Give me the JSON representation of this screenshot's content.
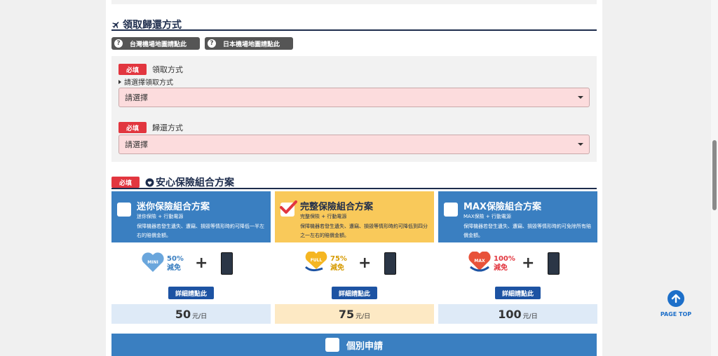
{
  "pickup_section": {
    "title": "領取歸還方式",
    "map_buttons": [
      {
        "label": "台灣機場地圖請點此"
      },
      {
        "label": "日本機場地圖請點此"
      }
    ],
    "required_badge": "必填",
    "pickup_label": "領取方式",
    "pickup_hint": "請選擇領取方式",
    "pickup_select_value": "請選擇",
    "return_label": "歸還方式",
    "return_select_value": "請選擇"
  },
  "insurance_section": {
    "required_badge": "必填",
    "title": "安心保險組合方案",
    "plans": [
      {
        "title": "迷你保險組合方案",
        "subtitle": "迷你保險 + 行動電源",
        "description": "保障機器若發生遺失、遭竊、損毀等情形時約可降低一半左右的賠償金額。",
        "badge_text": "MINI",
        "percent": "50%",
        "reduce": "減免",
        "plus": "+",
        "detail_button": "詳細請點此",
        "price": "50",
        "price_unit": "元/日",
        "checked": false,
        "colors": {
          "head": "#3a7fc1",
          "head_text": "#ffffff",
          "price_bg": "#deeaf7",
          "badge": "#6aa6dc",
          "pct": "#3a7fc1"
        }
      },
      {
        "title": "完整保險組合方案",
        "subtitle": "完整保險 + 行動電源",
        "description": "保障機器若發生遺失、遭竊、損毀等情形時約可降低到四分之一左右的賠償金額。",
        "badge_text": "FULL",
        "percent": "75%",
        "reduce": "減免",
        "plus": "+",
        "detail_button": "詳細請點此",
        "price": "75",
        "price_unit": "元/日",
        "checked": true,
        "colors": {
          "head": "#f9c95a",
          "head_text": "#1d2c4c",
          "price_bg": "#fde9c4",
          "badge": "#f5b622",
          "pct": "#d69a00"
        }
      },
      {
        "title": "MAX保險組合方案",
        "subtitle": "MAX保險 + 行動電源",
        "description": "保障機器若發生遺失、遭竊、損毀等情形時約可免除所有賠償金額。",
        "badge_text": "MAX",
        "percent": "100%",
        "reduce": "減免",
        "plus": "+",
        "detail_button": "詳細請點此",
        "price": "100",
        "price_unit": "元/日",
        "checked": false,
        "colors": {
          "head": "#3a7fc1",
          "head_text": "#ffffff",
          "price_bg": "#deeaf7",
          "badge": "#e8523a",
          "pct": "#e2363f"
        }
      }
    ]
  },
  "individual_apply": {
    "label": "個別申請"
  },
  "page_top": {
    "label": "PAGE TOP"
  },
  "colors": {
    "navy": "#1d2c4c",
    "required": "#e2363f",
    "select_bg": "#fcdcdd",
    "detail_button": "#1d53a3"
  }
}
